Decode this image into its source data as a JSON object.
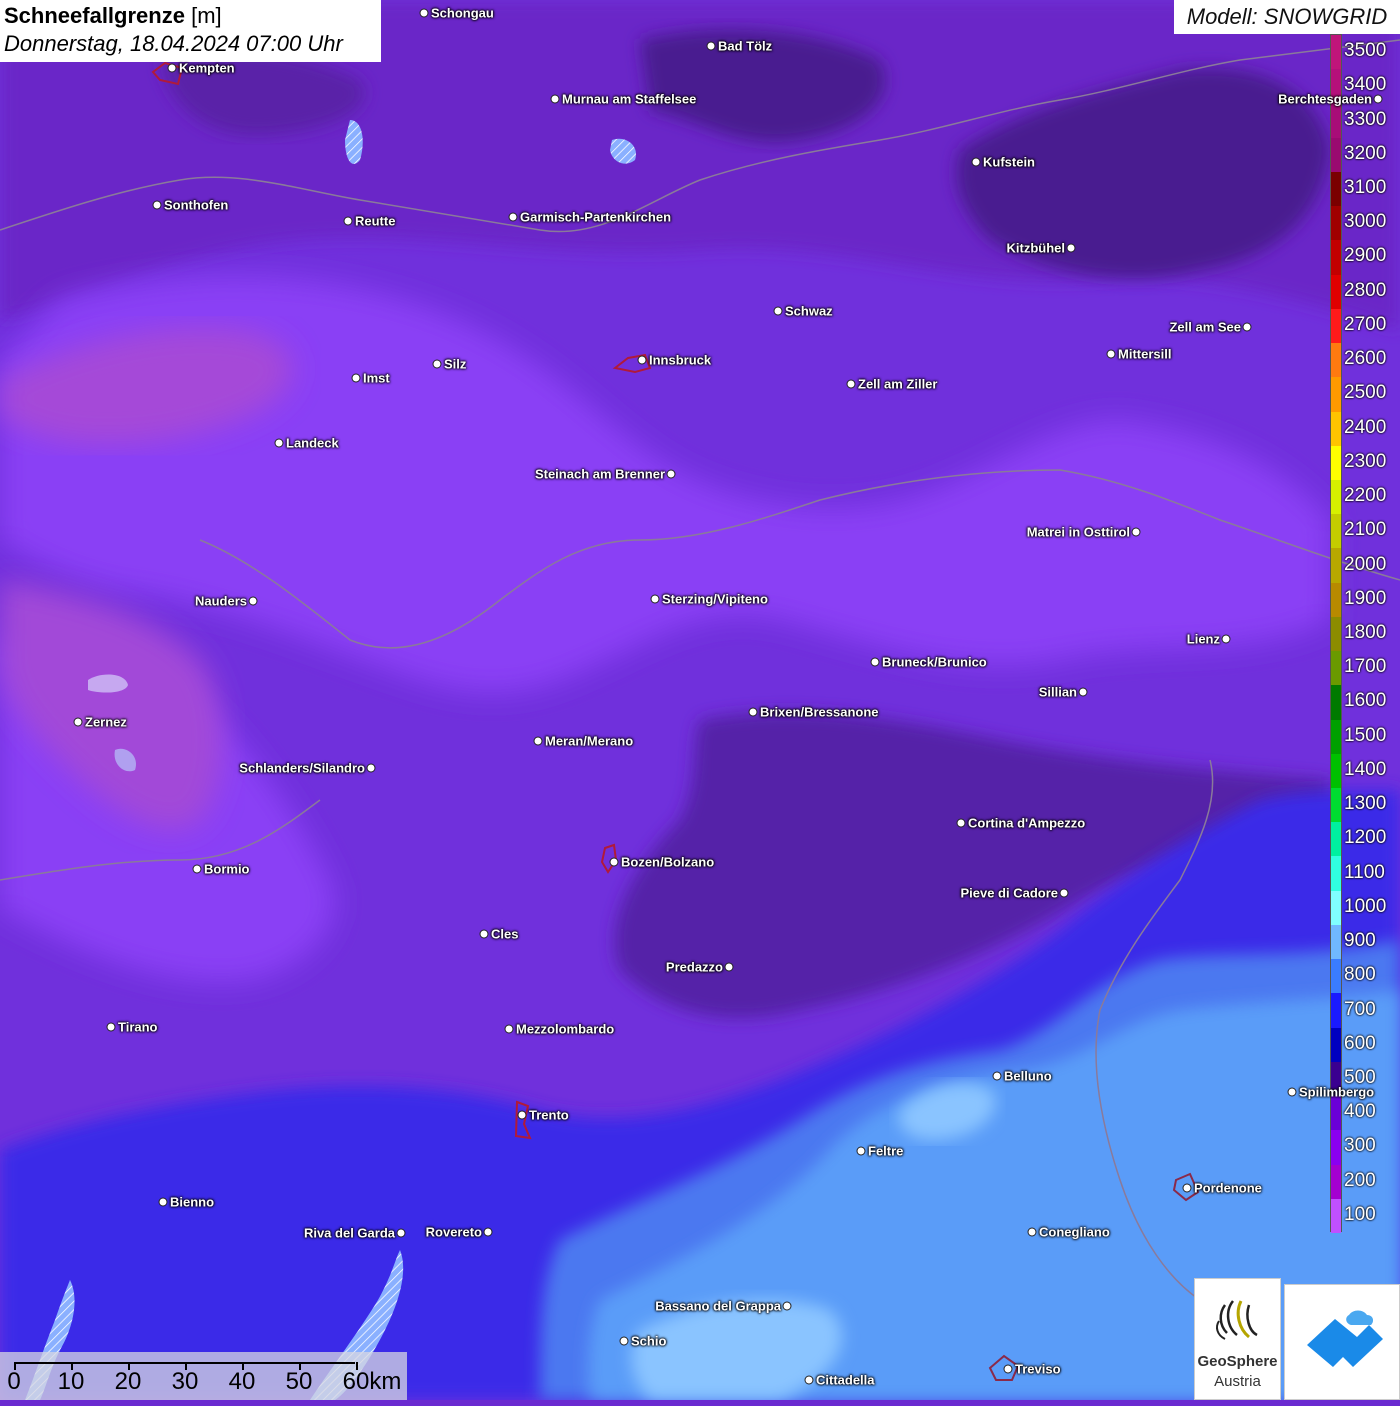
{
  "title": {
    "name": "Schneefallgrenze",
    "unit": "[m]",
    "datetime": "Donnerstag, 18.04.2024 07:00 Uhr"
  },
  "model": "Modell: SNOWGRID",
  "legend": {
    "labels": [
      "3500",
      "3400",
      "3300",
      "3200",
      "3100",
      "3000",
      "2900",
      "2800",
      "2700",
      "2600",
      "2500",
      "2400",
      "2300",
      "2200",
      "2100",
      "2000",
      "1900",
      "1800",
      "1700",
      "1600",
      "1500",
      "1400",
      "1300",
      "1200",
      "1100",
      "1000",
      "900",
      "800",
      "700",
      "600",
      "500",
      "400",
      "300",
      "200",
      "100"
    ],
    "colors": [
      "#c0157a",
      "#b5107a",
      "#a80d78",
      "#9a0a70",
      "#7a0000",
      "#a00000",
      "#c20000",
      "#e00000",
      "#ff1a1a",
      "#ff7a10",
      "#ff9a00",
      "#ffc400",
      "#ffff00",
      "#d6f000",
      "#c4cc00",
      "#b8a800",
      "#b88a00",
      "#8c8c00",
      "#6a9a00",
      "#007a00",
      "#00a000",
      "#00c000",
      "#00dc30",
      "#00f0a0",
      "#30ffe0",
      "#80ffff",
      "#70b8ff",
      "#3a7cff",
      "#1a1aff",
      "#0000c0",
      "#3a0090",
      "#6a00d8",
      "#8a00f0",
      "#a400d0",
      "#c050ff"
    ]
  },
  "cities": [
    {
      "name": "Schongau",
      "side": "r"
    },
    {
      "name": "Bad Tölz",
      "side": "r"
    },
    {
      "name": "Kempten",
      "side": "r"
    },
    {
      "name": "Murnau am Staffelsee",
      "side": "r"
    },
    {
      "name": "Berchtesgaden",
      "side": "l"
    },
    {
      "name": "Kufstein",
      "side": "r"
    },
    {
      "name": "Sonthofen",
      "side": "r"
    },
    {
      "name": "Reutte",
      "side": "r"
    },
    {
      "name": "Garmisch-Partenkirchen",
      "side": "r"
    },
    {
      "name": "Kitzbühel",
      "side": "l"
    },
    {
      "name": "Schwaz",
      "side": "r"
    },
    {
      "name": "Zell am See",
      "side": "l"
    },
    {
      "name": "Mittersill",
      "side": "r"
    },
    {
      "name": "Innsbruck",
      "side": "r"
    },
    {
      "name": "Silz",
      "side": "r"
    },
    {
      "name": "Imst",
      "side": "r"
    },
    {
      "name": "Zell am Ziller",
      "side": "r"
    },
    {
      "name": "Landeck",
      "side": "r"
    },
    {
      "name": "Steinach am Brenner",
      "side": "l"
    },
    {
      "name": "Matrei in Osttirol",
      "side": "l"
    },
    {
      "name": "Nauders",
      "side": "l"
    },
    {
      "name": "Sterzing/Vipiteno",
      "side": "r"
    },
    {
      "name": "Lienz",
      "side": "l"
    },
    {
      "name": "Bruneck/Brunico",
      "side": "r"
    },
    {
      "name": "Sillian",
      "side": "l"
    },
    {
      "name": "Zernez",
      "side": "r"
    },
    {
      "name": "Brixen/Bressanone",
      "side": "r"
    },
    {
      "name": "Meran/Merano",
      "side": "r"
    },
    {
      "name": "Schlanders/Silandro",
      "side": "l"
    },
    {
      "name": "Cortina d'Ampezzo",
      "side": "r"
    },
    {
      "name": "Bozen/Bolzano",
      "side": "r"
    },
    {
      "name": "Bormio",
      "side": "r"
    },
    {
      "name": "Pieve di Cadore",
      "side": "l"
    },
    {
      "name": "Cles",
      "side": "r"
    },
    {
      "name": "Predazzo",
      "side": "l"
    },
    {
      "name": "Tirano",
      "side": "r"
    },
    {
      "name": "Mezzolombardo",
      "side": "r"
    },
    {
      "name": "Belluno",
      "side": "r"
    },
    {
      "name": "Spilimbergo",
      "side": "r"
    },
    {
      "name": "Trento",
      "side": "r"
    },
    {
      "name": "Feltre",
      "side": "r"
    },
    {
      "name": "Pordenone",
      "side": "r"
    },
    {
      "name": "Bienno",
      "side": "r"
    },
    {
      "name": "Riva del Garda",
      "side": "l"
    },
    {
      "name": "Rovereto",
      "side": "l"
    },
    {
      "name": "Conegliano",
      "side": "r"
    },
    {
      "name": "Bassano del Grappa",
      "side": "l"
    },
    {
      "name": "Schio",
      "side": "r"
    },
    {
      "name": "Treviso",
      "side": "r"
    },
    {
      "name": "Cittadella",
      "side": "r"
    }
  ],
  "scale": {
    "labels": [
      "0",
      "10",
      "20",
      "30",
      "40",
      "50",
      "60km"
    ]
  },
  "logo": {
    "name_line1": "GeoSphere",
    "name_line2": "Austria"
  }
}
